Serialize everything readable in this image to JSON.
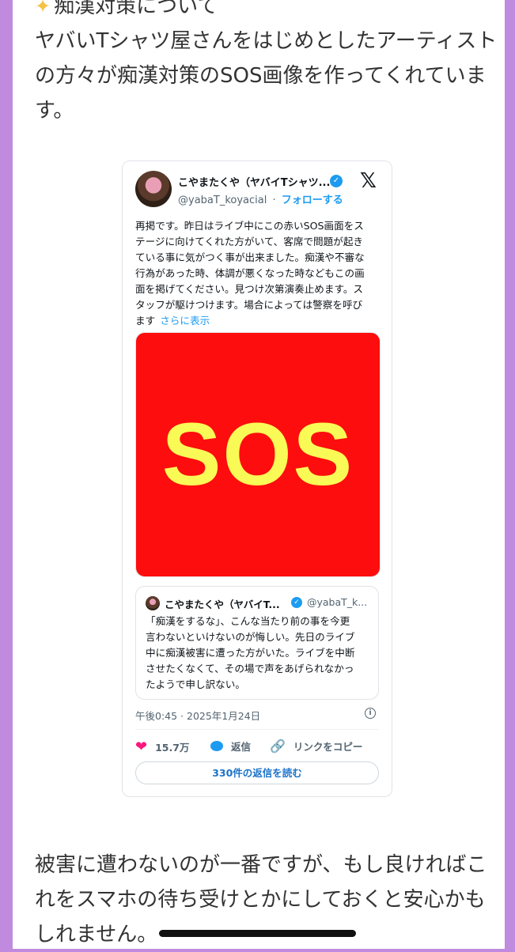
{
  "intro": {
    "heading": "痴漢対策について",
    "lines": [
      "ヤバいTシャツ屋さんをはじめとしたアーティスト",
      "の方々が痴漢対策のSOS画像を作ってくれていま",
      "す。"
    ]
  },
  "tweet": {
    "author_name": "こやまたくや（ヤバイTシャツ...",
    "handle": "@yabaT_koyacial",
    "separator": "·",
    "follow_label": "フォローする",
    "text_lines": [
      "再掲です。昨日はライブ中にこの赤いSOS画面をス",
      "テージに向けてくれた方がいて、客席で問題が起き",
      "ている事に気がつく事が出来ました。痴漢や不審な",
      "行為があった時、体調が悪くなった時などもこの画",
      "面を掲げてください。見つけ次第演奏止めます。ス",
      "タッフが駆けつけます。場合によっては警察を呼び",
      "ます"
    ],
    "more_label": "さらに表示",
    "image_text": "SOS",
    "quote": {
      "author_name": "こやまたくや（ヤバイT...",
      "handle": "@yabaT_k...",
      "text_lines": [
        "「痴漢をするな」、こんな当たり前の事を今更",
        "言わないといけないのが悔しい。先日のライブ",
        "中に痴漢被害に遭った方がいた。ライブを中断",
        "させたくなくて、その場で声をあげられなかっ",
        "たようで申し訳ない。"
      ]
    },
    "timestamp": "午後0:45 · 2025年1月24日",
    "likes": "15.7万",
    "reply_label": "返信",
    "copy_link_label": "リンクをコピー",
    "read_replies_label": "330件の返信を読む"
  },
  "outro": {
    "lines": [
      "被害に遭わないのが一番ですが、もし良ければこ",
      "れをスマホの待ち受けとかにしておくと安心かも",
      "しれません。"
    ]
  },
  "colors": {
    "page_border": "#c08adf",
    "sos_background": "#fd0d0d",
    "sos_text": "#fafa56",
    "twitter_blue": "#1d9bf0",
    "like_pink": "#f91880"
  },
  "icons": [
    "sparkle-icon",
    "verified-icon",
    "x-logo-icon",
    "info-icon",
    "heart-icon",
    "reply-icon",
    "link-icon"
  ]
}
